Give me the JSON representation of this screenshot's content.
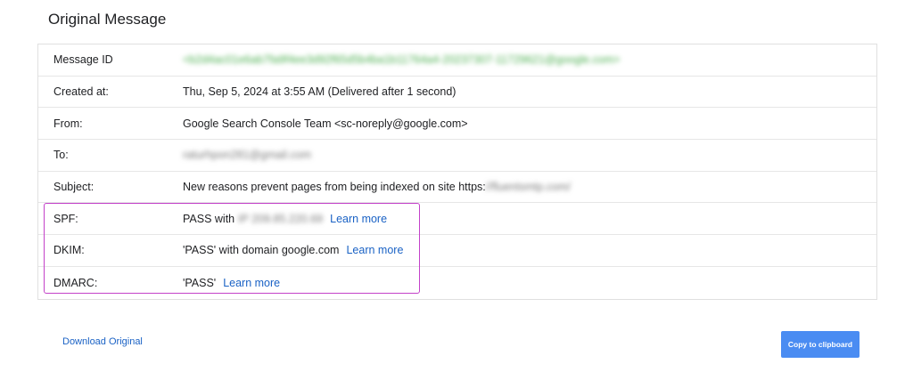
{
  "title": "Original Message",
  "rows": {
    "message_id": {
      "label": "Message ID",
      "value": "<b2d4ac01e6ab7fa9f4ee3d92f65d5b4ba1b11764a4-20237307-11729621@google.com>"
    },
    "created": {
      "label": "Created at:",
      "value": "Thu, Sep 5, 2024 at 3:55 AM (Delivered after 1 second)"
    },
    "from": {
      "label": "From:",
      "value": "Google Search Console Team <sc-noreply@google.com>"
    },
    "to": {
      "label": "To:",
      "value": "raturhpon281@gmail.com"
    },
    "subject": {
      "label": "Subject:",
      "value_prefix": "New reasons prevent pages from being indexed on site https:",
      "value_blurred": "//fluentsmtp.com/"
    },
    "spf": {
      "label": "SPF:",
      "value_prefix": "PASS with",
      "value_blurred": "IP 209.85.220.69",
      "link": "Learn more"
    },
    "dkim": {
      "label": "DKIM:",
      "value": "'PASS' with domain google.com",
      "link": "Learn more"
    },
    "dmarc": {
      "label": "DMARC:",
      "value": "'PASS'",
      "link": "Learn more"
    }
  },
  "footer": {
    "download_label": "Download Original",
    "copy_label": "Copy to clipboard"
  },
  "colors": {
    "link": "#1a62c5",
    "highlight": "#c341c9",
    "button": "#4a8cf2"
  }
}
